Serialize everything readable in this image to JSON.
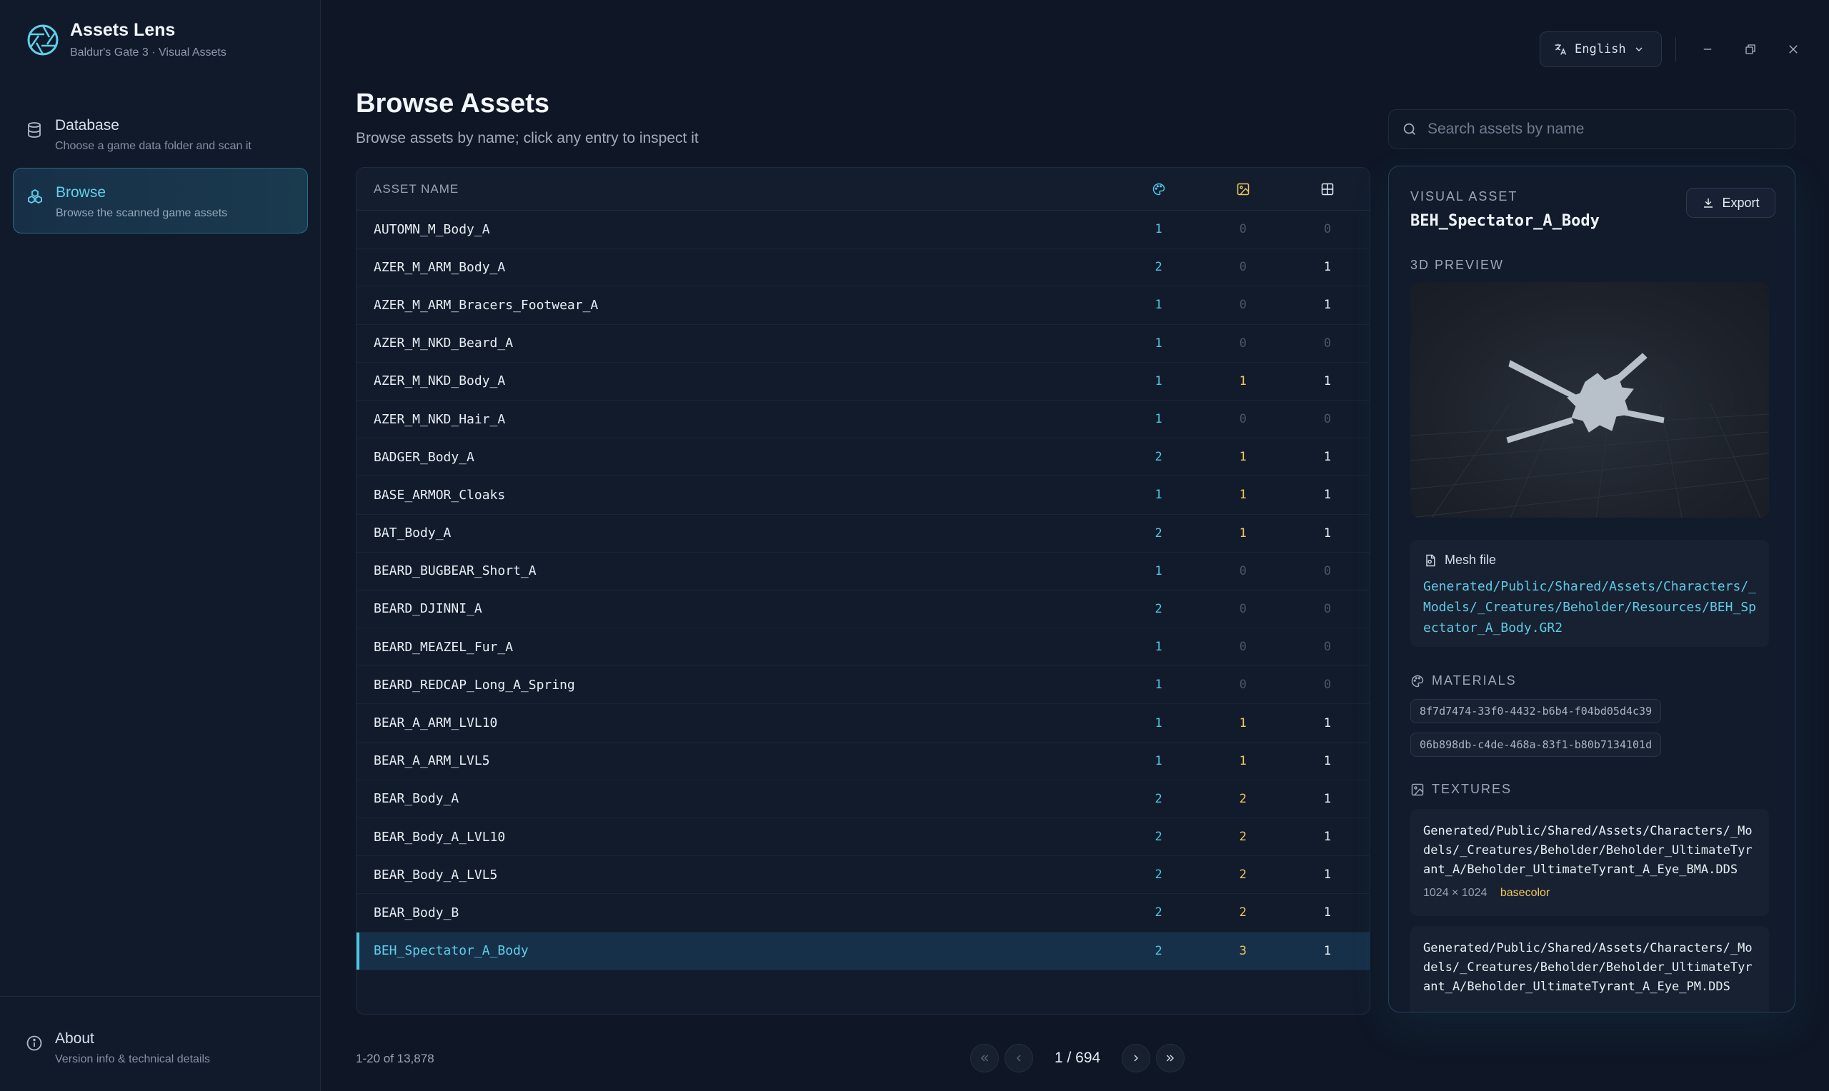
{
  "app": {
    "title": "Assets Lens",
    "subtitle": "Baldur's Gate 3 · Visual Assets"
  },
  "nav": {
    "database": {
      "label": "Database",
      "desc": "Choose a game data folder and scan it"
    },
    "browse": {
      "label": "Browse",
      "desc": "Browse the scanned game assets"
    },
    "about": {
      "label": "About",
      "desc": "Version info & technical details"
    }
  },
  "topbar": {
    "language": "English"
  },
  "header": {
    "title": "Browse Assets",
    "subtitle": "Browse assets by name; click any entry to inspect it"
  },
  "search": {
    "placeholder": "Search assets by name"
  },
  "table": {
    "name_header": "ASSET NAME",
    "column_icons": [
      "materials-icon",
      "textures-icon",
      "meshes-icon"
    ],
    "rows": [
      {
        "name": "AUTOMN_M_Body_A",
        "materials": 1,
        "textures": 0,
        "meshes": 0
      },
      {
        "name": "AZER_M_ARM_Body_A",
        "materials": 2,
        "textures": 0,
        "meshes": 1
      },
      {
        "name": "AZER_M_ARM_Bracers_Footwear_A",
        "materials": 1,
        "textures": 0,
        "meshes": 1
      },
      {
        "name": "AZER_M_NKD_Beard_A",
        "materials": 1,
        "textures": 0,
        "meshes": 0
      },
      {
        "name": "AZER_M_NKD_Body_A",
        "materials": 1,
        "textures": 1,
        "meshes": 1
      },
      {
        "name": "AZER_M_NKD_Hair_A",
        "materials": 1,
        "textures": 0,
        "meshes": 0
      },
      {
        "name": "BADGER_Body_A",
        "materials": 2,
        "textures": 1,
        "meshes": 1
      },
      {
        "name": "BASE_ARMOR_Cloaks",
        "materials": 1,
        "textures": 1,
        "meshes": 1
      },
      {
        "name": "BAT_Body_A",
        "materials": 2,
        "textures": 1,
        "meshes": 1
      },
      {
        "name": "BEARD_BUGBEAR_Short_A",
        "materials": 1,
        "textures": 0,
        "meshes": 0
      },
      {
        "name": "BEARD_DJINNI_A",
        "materials": 2,
        "textures": 0,
        "meshes": 0
      },
      {
        "name": "BEARD_MEAZEL_Fur_A",
        "materials": 1,
        "textures": 0,
        "meshes": 0
      },
      {
        "name": "BEARD_REDCAP_Long_A_Spring",
        "materials": 1,
        "textures": 0,
        "meshes": 0
      },
      {
        "name": "BEAR_A_ARM_LVL10",
        "materials": 1,
        "textures": 1,
        "meshes": 1
      },
      {
        "name": "BEAR_A_ARM_LVL5",
        "materials": 1,
        "textures": 1,
        "meshes": 1
      },
      {
        "name": "BEAR_Body_A",
        "materials": 2,
        "textures": 2,
        "meshes": 1
      },
      {
        "name": "BEAR_Body_A_LVL10",
        "materials": 2,
        "textures": 2,
        "meshes": 1
      },
      {
        "name": "BEAR_Body_A_LVL5",
        "materials": 2,
        "textures": 2,
        "meshes": 1
      },
      {
        "name": "BEAR_Body_B",
        "materials": 2,
        "textures": 2,
        "meshes": 1
      },
      {
        "name": "BEH_Spectator_A_Body",
        "materials": 2,
        "textures": 3,
        "meshes": 1,
        "selected": true
      }
    ]
  },
  "pagination": {
    "range": "1-20 of 13,878",
    "page": "1 / 694"
  },
  "detail": {
    "kicker": "VISUAL ASSET",
    "name": "BEH_Spectator_A_Body",
    "export_label": "Export",
    "preview_label": "3D PREVIEW",
    "mesh_label": "Mesh file",
    "mesh_path": "Generated/Public/Shared/Assets/Characters/_Models/_Creatures/Beholder/Resources/BEH_Spectator_A_Body.GR2",
    "materials_label": "MATERIALS",
    "materials": [
      "8f7d7474-33f0-4432-b6b4-f04bd05d4c39",
      "06b898db-c4de-468a-83f1-b80b7134101d"
    ],
    "textures_label": "TEXTURES",
    "textures": [
      {
        "path": "Generated/Public/Shared/Assets/Characters/_Models/_Creatures/Beholder/Beholder_UltimateTyrant_A/Beholder_UltimateTyrant_A_Eye_BMA.DDS",
        "size": "1024 × 1024",
        "tag": "basecolor"
      },
      {
        "path": "Generated/Public/Shared/Assets/Characters/_Models/_Creatures/Beholder/Beholder_UltimateTyrant_A/Beholder_UltimateTyrant_A_Eye_PM.DDS"
      }
    ]
  },
  "colors": {
    "accent": "#4fc6e3",
    "texture": "#f0c75e",
    "bg": "#0f1726"
  }
}
